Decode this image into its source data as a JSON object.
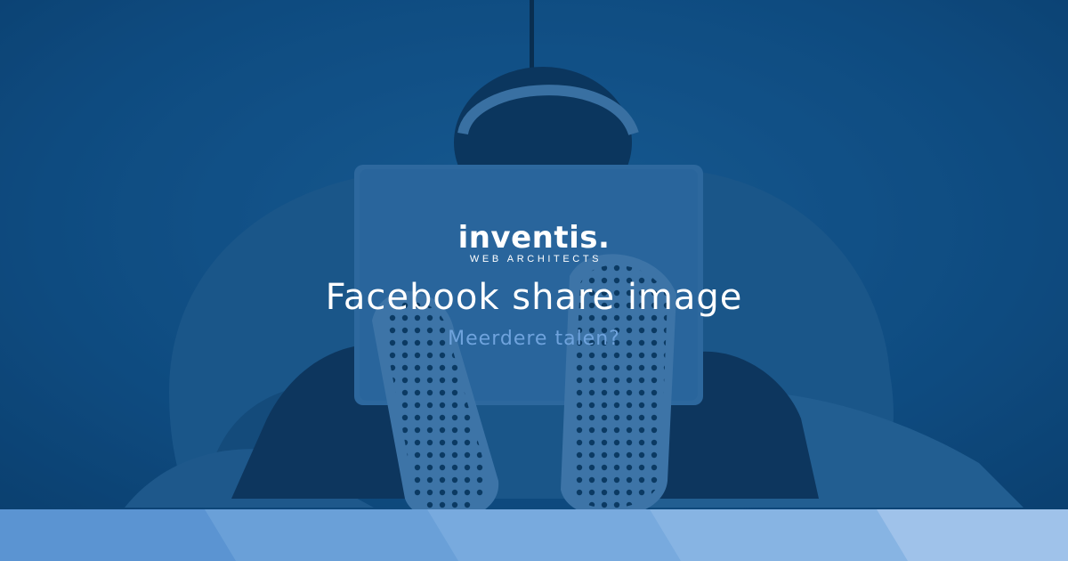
{
  "brand": {
    "name": "inventis.",
    "tagline": "WEB ARCHITECTS"
  },
  "headline": {
    "title": "Facebook share image",
    "subtitle": "Meerdere talen?"
  },
  "colors": {
    "background_tint": "#0e4a7e",
    "title_text": "#ffffff",
    "subtitle_text": "#6fa3dd",
    "stripe_1": "#5b94d2",
    "stripe_2": "#6aa0d8",
    "stripe_3": "#78aade",
    "stripe_4": "#87b4e3",
    "stripe_5": "#9fc2ea"
  }
}
